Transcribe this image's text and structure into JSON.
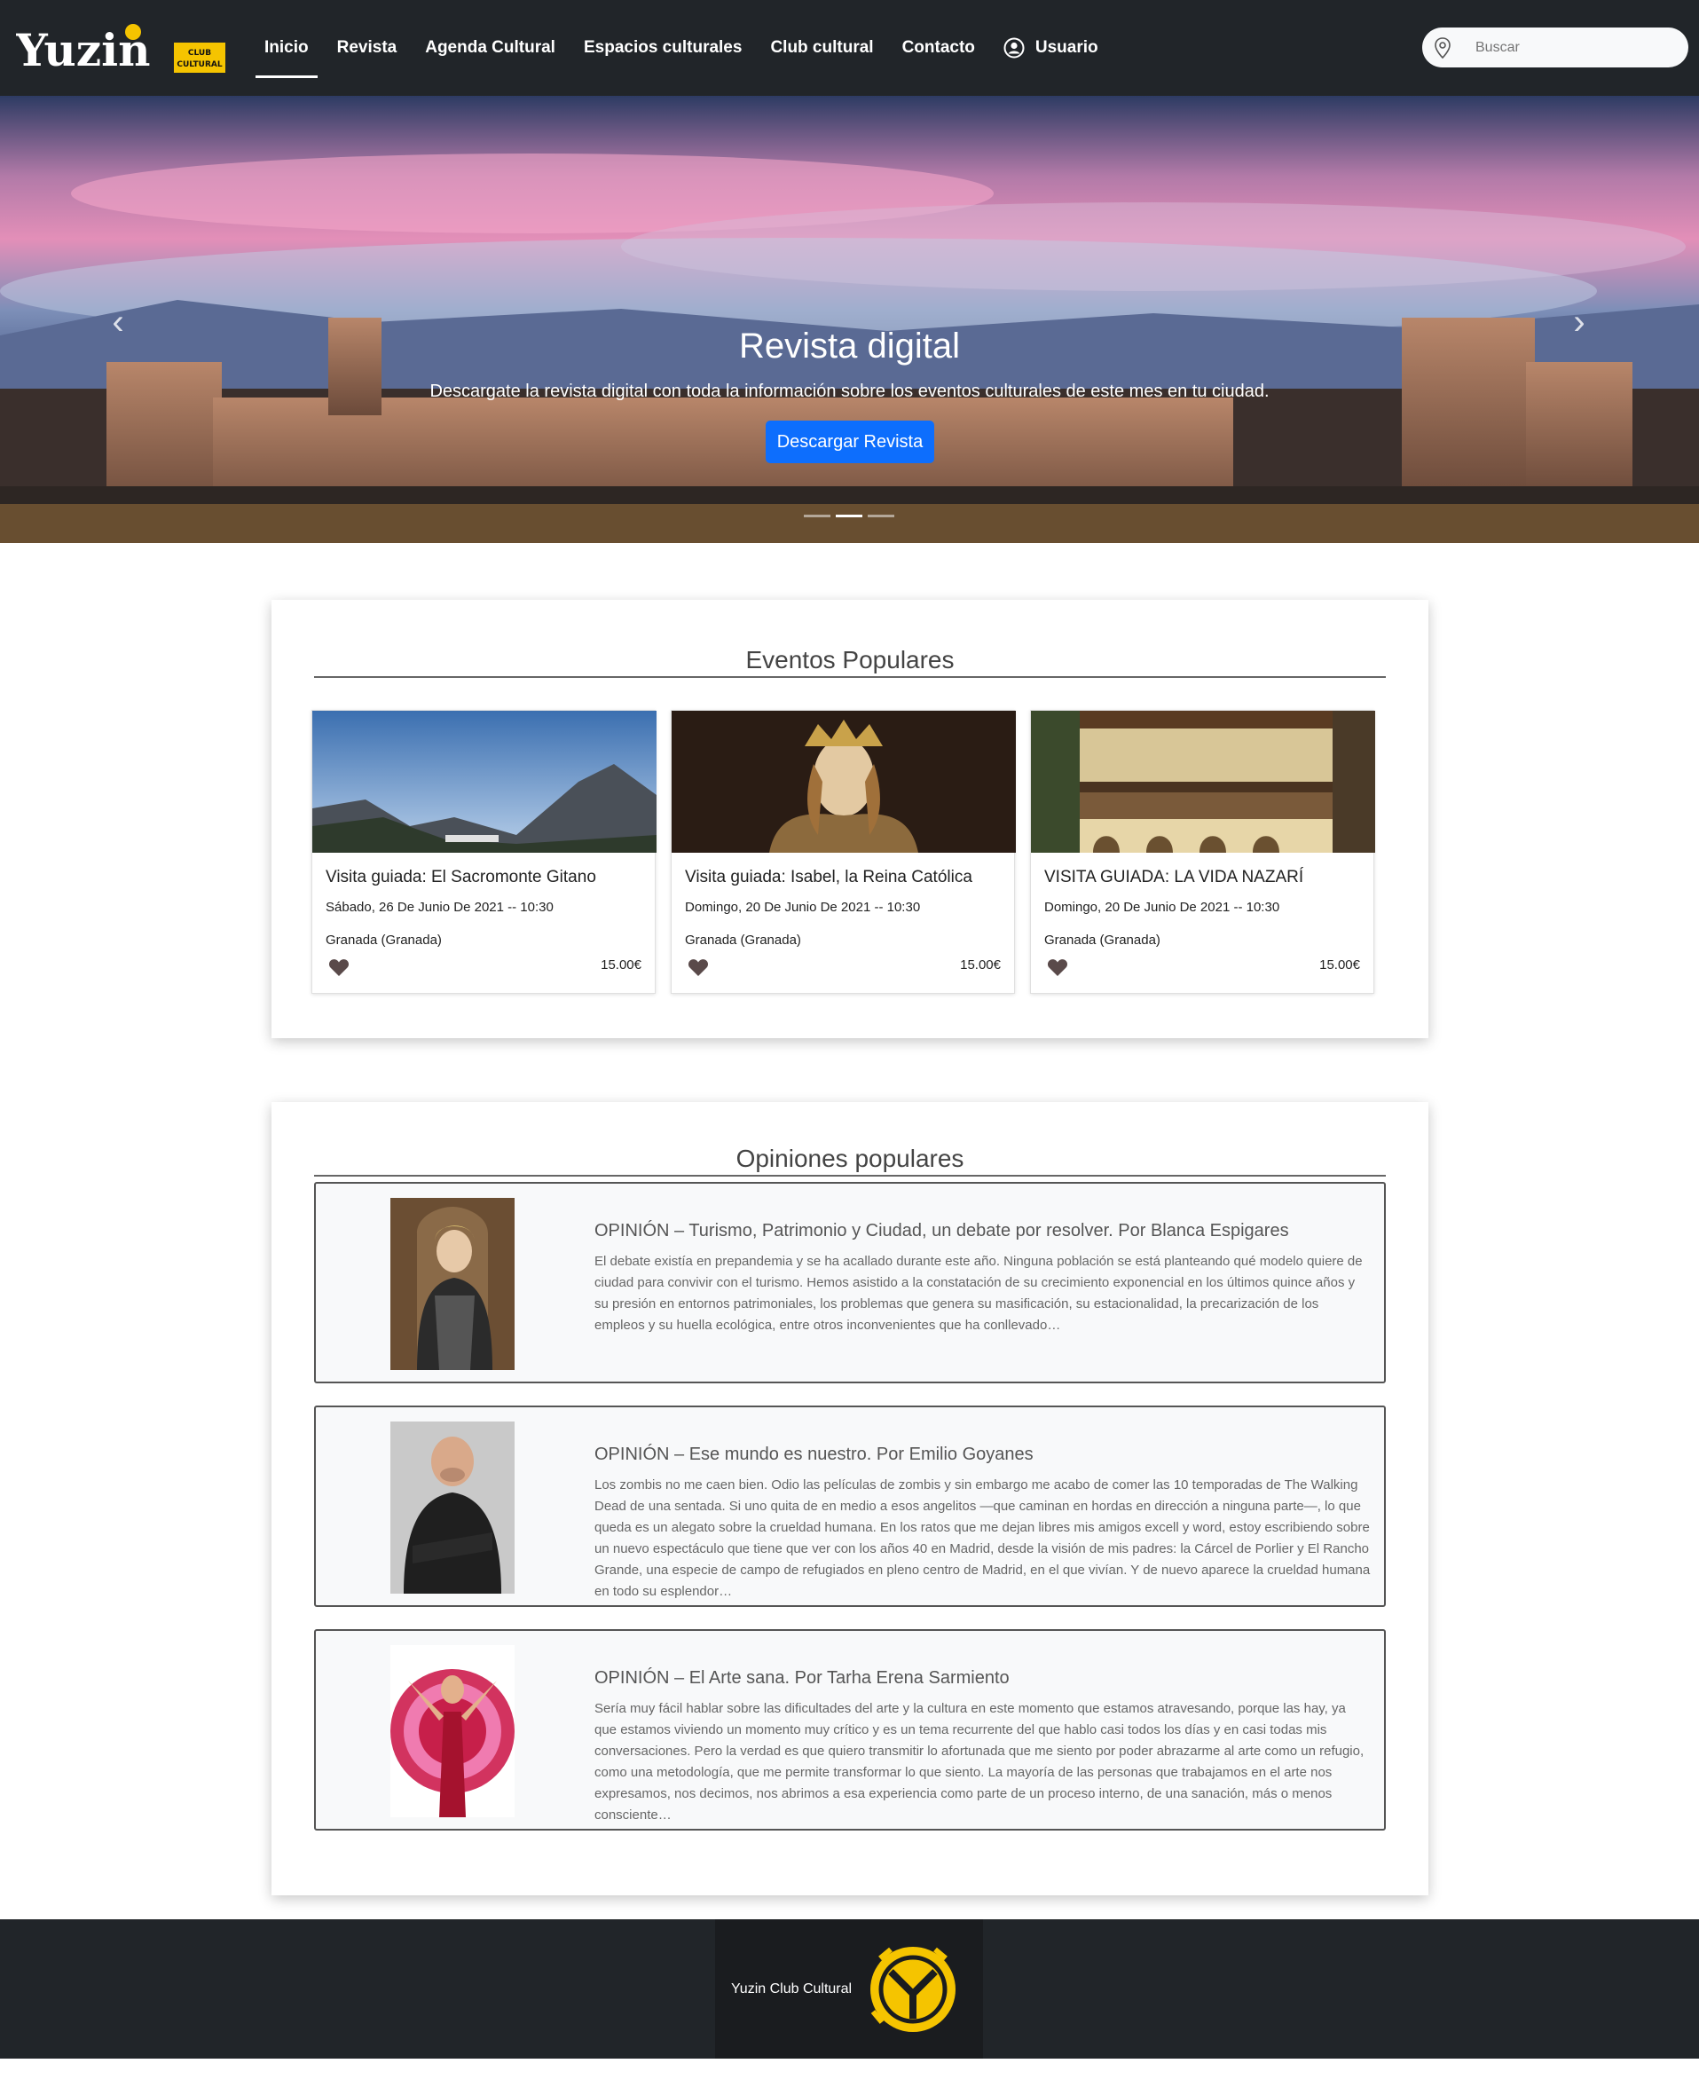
{
  "navbar": {
    "logo_text": "Yuzin",
    "logo_badge": "CLUB CULTURAL",
    "links": [
      {
        "label": "Inicio",
        "active": true
      },
      {
        "label": "Revista",
        "active": false
      },
      {
        "label": "Agenda Cultural",
        "active": false
      },
      {
        "label": "Espacios culturales",
        "active": false
      },
      {
        "label": "Club cultural",
        "active": false
      },
      {
        "label": "Contacto",
        "active": false
      }
    ],
    "user_label": "Usuario",
    "user_icon": "user-circle-icon",
    "search": {
      "placeholder": "Buscar",
      "value": "",
      "icon": "map-pin-icon"
    }
  },
  "hero": {
    "title": "Revista digital",
    "description": "Descargate la revista digital con toda la información sobre los eventos culturales de este mes en tu ciudad.",
    "button_label": "Descargar Revista",
    "prev_icon": "chevron-left-icon",
    "next_icon": "chevron-right-icon",
    "slide_count": 3,
    "active_slide": 2
  },
  "events": {
    "title": "Eventos Populares",
    "items": [
      {
        "title": "Visita guiada: El Sacromonte Gitano",
        "date": "Sábado, 26 De Junio De 2021 -- 10:30",
        "place": "Granada (Granada)",
        "price": "15.00€",
        "image": "mountain-landscape"
      },
      {
        "title": "Visita guiada: Isabel, la Reina Católica",
        "date": "Domingo, 20 De Junio De 2021 -- 10:30",
        "place": "Granada (Granada)",
        "price": "15.00€",
        "image": "queen-portrait"
      },
      {
        "title": "VISITA GUIADA: LA VIDA NAZARÍ",
        "date": "Domingo, 20 De Junio De 2021 -- 10:30",
        "place": "Granada (Granada)",
        "price": "15.00€",
        "image": "courtyard-balcony"
      }
    ]
  },
  "opinions": {
    "title": "Opiniones populares",
    "items": [
      {
        "title": "OPINIÓN – Turismo, Patrimonio y Ciudad, un debate por resolver. Por Blanca Espigares",
        "text": "El debate existía en prepandemia y se ha acallado durante este año. Ninguna población se está planteando qué modelo quiere de ciudad para convivir con el turismo. Hemos asistido a la constatación de su crecimiento exponencial en los últimos quince años y su presión en entornos patrimoniales, los problemas que genera su masificación, su estacionalidad, la precarización de los empleos y su huella ecológica, entre otros inconvenientes que ha conllevado…"
      },
      {
        "title": "OPINIÓN – Ese mundo es nuestro. Por Emilio Goyanes",
        "text": "Los zombis no me caen bien. Odio las películas de zombis y sin embargo me acabo de comer las 10 temporadas de The Walking Dead de una sentada. Si uno quita de en medio a esos angelitos —que caminan en hordas en dirección a ninguna parte—, lo que queda es un alegato sobre la crueldad humana. En los ratos que me dejan libres mis amigos excell y word, estoy escribiendo sobre un nuevo espectáculo que tiene que ver con los años 40 en Madrid, desde la visión de mis padres: la Cárcel de Porlier y El Rancho Grande, una especie de campo de refugiados en pleno centro de Madrid, en el que vivían. Y de nuevo aparece la crueldad humana en todo su esplendor…"
      },
      {
        "title": "OPINIÓN – El Arte sana. Por Tarha Erena Sarmiento",
        "text": "Sería muy fácil hablar sobre las dificultades del arte y la cultura en este momento que estamos atravesando, porque las hay, ya que estamos viviendo un momento muy crítico y es un tema recurrente del que hablo casi todos los días y en casi todas mis conversaciones. Pero la verdad es que quiero transmitir lo afortunada que me siento por poder abrazarme al arte como un refugio, como una metodología, que me permite transformar lo que siento. La mayoría de las personas que trabajamos en el arte nos expresamos, nos decimos, nos abrimos a esa experiencia como parte de un proceso interno, de una sanación, más o menos consciente…"
      }
    ]
  },
  "footer": {
    "text": "Yuzin Club Cultural",
    "logo": "yuzin-emblem"
  },
  "colors": {
    "navbar_bg": "#212529",
    "accent": "#0d6efd",
    "brand_yellow": "#f5c400",
    "heart": "#5a4a4a"
  }
}
